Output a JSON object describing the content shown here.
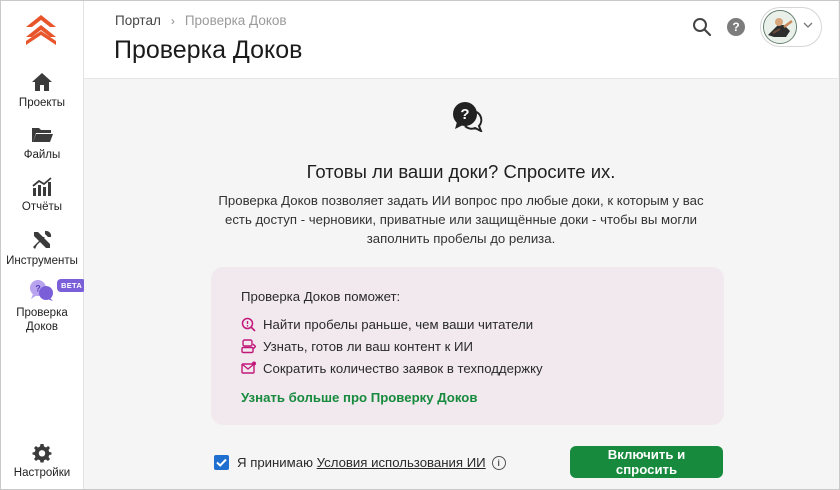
{
  "sidebar": {
    "items": [
      {
        "label": "Проекты",
        "icon": "home-icon"
      },
      {
        "label": "Файлы",
        "icon": "folder-icon"
      },
      {
        "label": "Отчёты",
        "icon": "reports-chart-icon"
      },
      {
        "label": "Инструменты",
        "icon": "tools-icon"
      },
      {
        "label": "Проверка\nДоков",
        "icon": "chat-question-icon",
        "badge": "BETA"
      }
    ],
    "settings_label": "Настройки"
  },
  "header": {
    "breadcrumb": {
      "root": "Портал",
      "separator": "›",
      "current": "Проверка Доков"
    },
    "title": "Проверка Доков",
    "help_label": "?"
  },
  "main": {
    "heading": "Готовы ли ваши доки? Спросите их.",
    "description": "Проверка Доков позволяет задать ИИ вопрос про любые доки, к которым у вас есть доступ - черновики, приватные или защищённые доки - чтобы вы могли заполнить пробелы до релиза.",
    "card": {
      "title": "Проверка Доков поможет:",
      "features": [
        "Найти пробелы раньше, чем ваши читатели",
        "Узнать, готов ли ваш контент к ИИ",
        "Сократить количество заявок в техподдержку"
      ],
      "learn_more": "Узнать больше про Проверку Доков"
    },
    "consent": {
      "checked": true,
      "prefix": "Я принимаю",
      "link": "Условия использования ИИ",
      "info": "i"
    },
    "submit_label": "Включить и спросить"
  },
  "colors": {
    "accent_green": "#178a3d",
    "brand_orange": "#e8552a",
    "beta_purple": "#7b5fd9",
    "card_bg": "#f1e9ee",
    "feature_icon": "#c2187a"
  }
}
